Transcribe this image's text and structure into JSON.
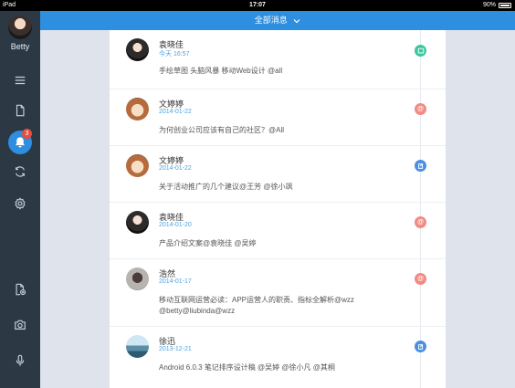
{
  "statusbar": {
    "device": "iPad",
    "time": "17:07",
    "battery": "90%",
    "battery_fraction": 0.9
  },
  "sidebar": {
    "user_name": "Betty",
    "notification_count": "3",
    "items": [
      {
        "icon": "menu-icon"
      },
      {
        "icon": "document-icon"
      },
      {
        "icon": "bell-icon"
      },
      {
        "icon": "refresh-icon"
      },
      {
        "icon": "settings-icon"
      },
      {
        "icon": "new-document-icon"
      },
      {
        "icon": "camera-icon"
      },
      {
        "icon": "microphone-icon"
      }
    ]
  },
  "header": {
    "title": "全部消息"
  },
  "colors": {
    "accent": "#2e8ee0",
    "sidebar": "#2c3945",
    "mention": "#f28b82",
    "comment": "#3cc7a0",
    "edit": "#4a90e2"
  },
  "feed": [
    {
      "name": "袁晓佳",
      "date": "今天 16:57",
      "text": "手绘草图 头脑风暴 移动Web设计 @all",
      "marker": "comment"
    },
    {
      "name": "文婷婷",
      "date": "2014-01-22",
      "text": "为何创业公司应该有自己的社区？@All",
      "marker": "mention"
    },
    {
      "name": "文婷婷",
      "date": "2014-01-22",
      "text": "关于活动推广的几个建议@王芳 @徐小飒",
      "marker": "edit"
    },
    {
      "name": "袁晓佳",
      "date": "2014-01-20",
      "text": "产品介绍文案@袁晓佳 @吴婷",
      "marker": "mention"
    },
    {
      "name": "浩然",
      "date": "2014-01-17",
      "text": "移动互联网运营必读：APP运营人的职责、指标全解析@wzz @betty@liubinda@wzz",
      "marker": "mention"
    },
    {
      "name": "徐迅",
      "date": "2013-12-21",
      "text": "Android 6.0.3 笔记排序设计稿 @吴婷 @徐小凡 @其桐",
      "marker": "edit"
    }
  ]
}
